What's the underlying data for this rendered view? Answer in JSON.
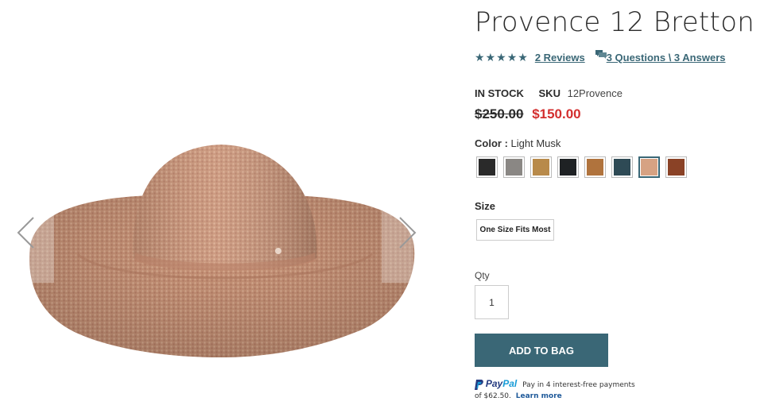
{
  "product": {
    "title": "Provence 12 Bretton",
    "rating": 5,
    "rating_stars": [
      "★",
      "★",
      "★",
      "★",
      "★"
    ],
    "reviews_link": "2 Reviews",
    "qa_link": "3 Questions \\ 3 Answers",
    "stock_status": "IN STOCK",
    "sku_label": "SKU",
    "sku": "12Provence",
    "old_price": "$250.00",
    "price": "$150.00"
  },
  "color": {
    "label": "Color",
    "separator": " : ",
    "selected": "Light Musk",
    "swatches": [
      {
        "name": "black",
        "color": "#2a2a2a"
      },
      {
        "name": "grey",
        "color": "#8a8784"
      },
      {
        "name": "leopard",
        "color": "#b88a4a"
      },
      {
        "name": "charcoal",
        "color": "#1f2224"
      },
      {
        "name": "tan",
        "color": "#b0733d"
      },
      {
        "name": "navy-teal",
        "color": "#2e4a55"
      },
      {
        "name": "light-musk",
        "color": "#d6a283"
      },
      {
        "name": "brown-stripe",
        "color": "#8a4226"
      }
    ],
    "selected_index": 6
  },
  "size": {
    "label": "Size",
    "option": "One Size Fits Most"
  },
  "qty": {
    "label": "Qty",
    "value": "1"
  },
  "cart": {
    "add_label": "ADD TO BAG"
  },
  "paypal": {
    "pay": "Pay",
    "pal": "Pal",
    "message": "Pay in 4 interest-free payments",
    "message2": "of $62.50.",
    "learn_more": "Learn more"
  },
  "colors": {
    "accent": "#3a6776",
    "sale": "#d32f2f"
  }
}
